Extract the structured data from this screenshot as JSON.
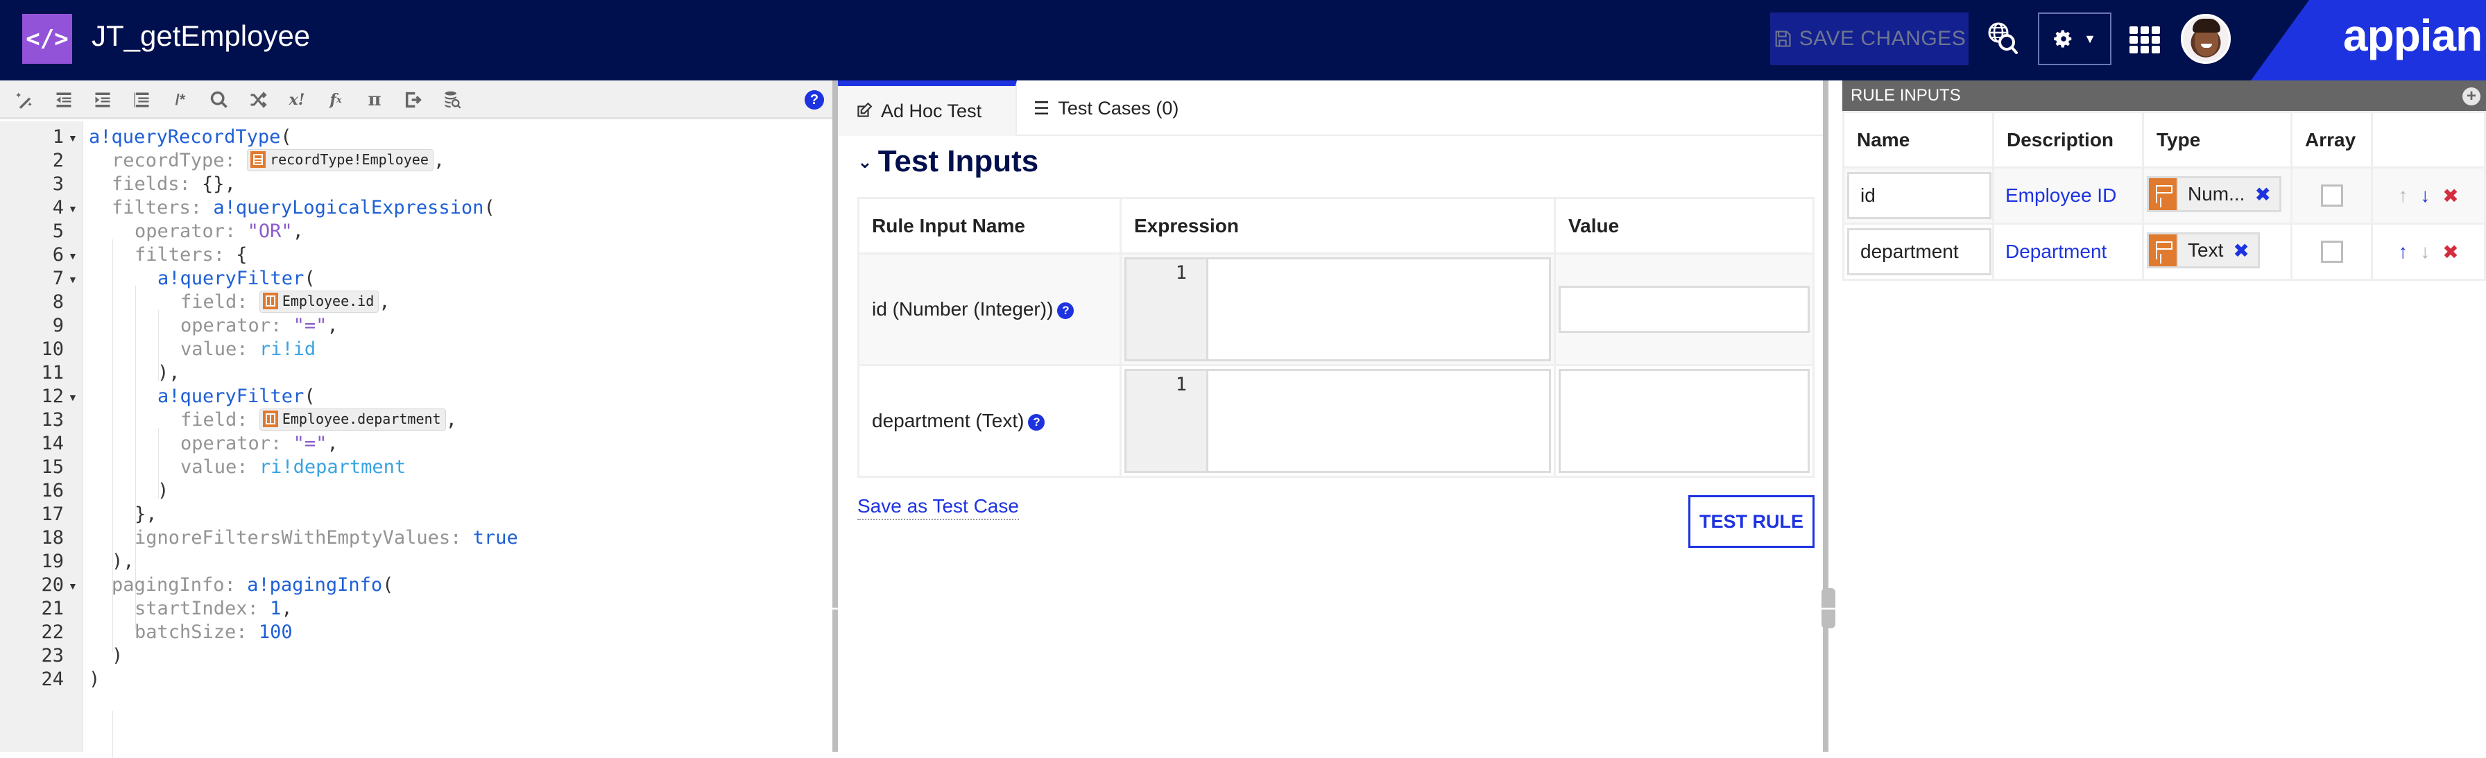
{
  "header": {
    "logo_icon": "code-brackets-icon",
    "logo_glyph": "</>",
    "title": "JT_getEmployee",
    "save_changes_label": "SAVE CHANGES",
    "brand": "appian",
    "icons": [
      "save-icon",
      "globe-search-icon",
      "gear-icon",
      "caret-down-icon",
      "apps-grid-icon",
      "avatar"
    ]
  },
  "editor": {
    "toolbar_icons": [
      "magic-wand-icon",
      "outdent-icon",
      "indent-icon",
      "format-lines-icon",
      "comment-icon",
      "search-icon",
      "shuffle-icon",
      "variable-icon",
      "function-icon",
      "pi-icon",
      "export-icon",
      "database-search-icon"
    ],
    "help_glyph": "?",
    "lines": [
      {
        "num": "1",
        "fold": true
      },
      {
        "num": "2"
      },
      {
        "num": "3"
      },
      {
        "num": "4",
        "fold": true
      },
      {
        "num": "5"
      },
      {
        "num": "6",
        "fold": true
      },
      {
        "num": "7",
        "fold": true
      },
      {
        "num": "8"
      },
      {
        "num": "9"
      },
      {
        "num": "10"
      },
      {
        "num": "11"
      },
      {
        "num": "12",
        "fold": true
      },
      {
        "num": "13"
      },
      {
        "num": "14"
      },
      {
        "num": "15"
      },
      {
        "num": "16"
      },
      {
        "num": "17"
      },
      {
        "num": "18"
      },
      {
        "num": "19"
      },
      {
        "num": "20",
        "fold": true
      },
      {
        "num": "21"
      },
      {
        "num": "22"
      },
      {
        "num": "23"
      },
      {
        "num": "24"
      }
    ],
    "code": {
      "l1_fn": "a!queryRecordType",
      "l1_p": "(",
      "l2_key": "recordType:",
      "l2_token": "recordType!Employee",
      "l2_p": ",",
      "l3_key": "fields:",
      "l3_p": " {},",
      "l4_key": "filters:",
      "l4_fn": "a!queryLogicalExpression",
      "l4_p": "(",
      "l5_key": "operator:",
      "l5_str": "\"OR\"",
      "l5_p": ",",
      "l6_key": "filters:",
      "l6_p": " {",
      "l7_fn": "a!queryFilter",
      "l7_p": "(",
      "l8_key": "field:",
      "l8_token": "Employee.id",
      "l8_p": ",",
      "l9_key": "operator:",
      "l9_str": "\"=\"",
      "l9_p": ",",
      "l10_key": "value:",
      "l10_ri": "ri!id",
      "l11_p": "),",
      "l12_fn": "a!queryFilter",
      "l12_p": "(",
      "l13_key": "field:",
      "l13_token": "Employee.department",
      "l13_p": ",",
      "l14_key": "operator:",
      "l14_str": "\"=\"",
      "l14_p": ",",
      "l15_key": "value:",
      "l15_ri": "ri!department",
      "l16_p": ")",
      "l17_p": "},",
      "l18_key": "ignoreFiltersWithEmptyValues:",
      "l18_val": "true",
      "l19_p": "),",
      "l20_key": "pagingInfo:",
      "l20_fn": "a!pagingInfo",
      "l20_p": "(",
      "l21_key": "startIndex:",
      "l21_val": "1",
      "l21_p": ",",
      "l22_key": "batchSize:",
      "l22_val": "100",
      "l23_p": ")",
      "l24_p": ")"
    }
  },
  "test_pane": {
    "tabs": [
      {
        "label": "Ad Hoc Test",
        "icon": "edit-icon",
        "active": true
      },
      {
        "label": "Test Cases (0)",
        "icon": "list-icon",
        "active": false
      }
    ],
    "section_title": "Test Inputs",
    "columns": [
      "Rule Input Name",
      "Expression",
      "Value"
    ],
    "rows": [
      {
        "name": "id (Number (Integer))",
        "expr_line": "1",
        "value": ""
      },
      {
        "name": "department (Text)",
        "expr_line": "1",
        "value": ""
      }
    ],
    "save_as_test_case": "Save as Test Case",
    "test_rule_label": "TEST RULE"
  },
  "rule_inputs": {
    "title": "RULE INPUTS",
    "add_glyph": "+",
    "columns": [
      "Name",
      "Description",
      "Type",
      "Array",
      ""
    ],
    "rows": [
      {
        "name": "id",
        "description": "Employee ID",
        "type": "Num...",
        "array": false,
        "up_enabled": false,
        "down_enabled": true
      },
      {
        "name": "department",
        "description": "Department",
        "type": "Text",
        "array": false,
        "up_enabled": true,
        "down_enabled": false
      }
    ]
  },
  "glyphs": {
    "up": "↑",
    "down": "↓",
    "remove": "✖",
    "remove_type": "✖",
    "left_arrow": "🡐",
    "right_arrow": "🡒",
    "chevron": "⌄"
  },
  "colors": {
    "header_bg": "#000f4d",
    "accent": "#1d33e0",
    "logo_purple": "#9353d9",
    "token_orange": "#e07a2e",
    "danger": "#d22e3f"
  }
}
